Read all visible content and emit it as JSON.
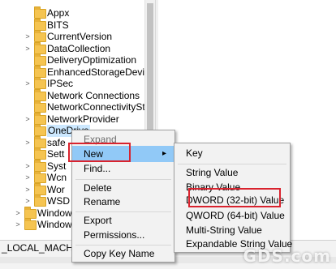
{
  "tree": {
    "items": [
      {
        "label": "Appx",
        "exp": ""
      },
      {
        "label": "BITS",
        "exp": ""
      },
      {
        "label": "CurrentVersion",
        "exp": ">"
      },
      {
        "label": "DataCollection",
        "exp": ">"
      },
      {
        "label": "DeliveryOptimization",
        "exp": ""
      },
      {
        "label": "EnhancedStorageDevices",
        "exp": ""
      },
      {
        "label": "IPSec",
        "exp": ">"
      },
      {
        "label": "Network Connections",
        "exp": ""
      },
      {
        "label": "NetworkConnectivityStatusI",
        "exp": ""
      },
      {
        "label": "NetworkProvider",
        "exp": ">"
      },
      {
        "label": "OneDrive",
        "exp": ""
      },
      {
        "label": "safe",
        "exp": ">"
      },
      {
        "label": "Sett",
        "exp": ""
      },
      {
        "label": "Syst",
        "exp": ">"
      },
      {
        "label": "Wcn",
        "exp": ">"
      },
      {
        "label": "Wor",
        "exp": ">"
      },
      {
        "label": "WSD",
        "exp": ">"
      },
      {
        "label": "Window",
        "exp": ">"
      },
      {
        "label": "Window",
        "exp": ">"
      }
    ]
  },
  "statusbar": {
    "path": "_LOCAL_MACHIN"
  },
  "context_menu": {
    "expand": "Expand",
    "new": "New",
    "find": "Find...",
    "delete": "Delete",
    "rename": "Rename",
    "export": "Export",
    "permissions": "Permissions...",
    "copy_key_name": "Copy Key Name"
  },
  "submenu": {
    "key": "Key",
    "string_value": "String Value",
    "binary_value": "Binary Value",
    "dword_value": "DWORD (32-bit) Value",
    "qword_value": "QWORD (64-bit) Value",
    "multi_string_value": "Multi-String Value",
    "expandable_string_value": "Expandable String Value"
  },
  "watermark": "GDS.com",
  "colors": {
    "highlight": "#91c9f7",
    "annotation": "#d9232e",
    "folder": "#f5c451"
  }
}
